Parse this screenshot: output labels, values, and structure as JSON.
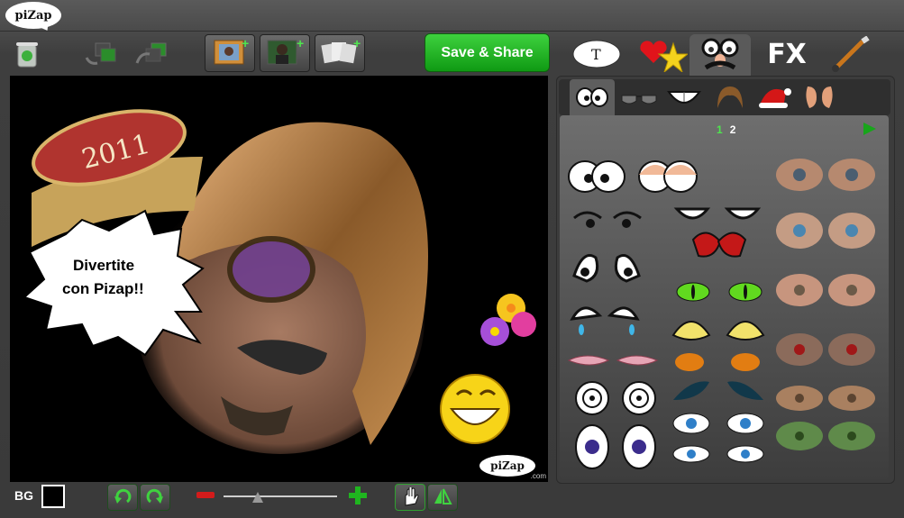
{
  "app": {
    "logo": "piZap"
  },
  "toolbar": {
    "save_label": "Save & Share"
  },
  "tabs_top": [
    "text-tab",
    "stickers-tab",
    "disguise-tab",
    "fx-tab",
    "paint-tab"
  ],
  "tabs_top_labels": {
    "text": "T",
    "fx": "FX"
  },
  "sub_tabs": [
    "eyes",
    "sunglasses",
    "teeth",
    "hair",
    "hats",
    "ears"
  ],
  "pager": {
    "page1": "1",
    "page2": "2"
  },
  "canvas": {
    "badge_text": "2011",
    "bubble_line1": "Divertite",
    "bubble_line2": "con Pizap!!",
    "watermark": "piZap",
    "watermark_suffix": ".com"
  },
  "bottom": {
    "bg_label": "BG"
  },
  "colors": {
    "accent_green": "#18a51b",
    "bubble_red": "#b0342f"
  },
  "slider": {
    "zoom_level": 0.3
  }
}
